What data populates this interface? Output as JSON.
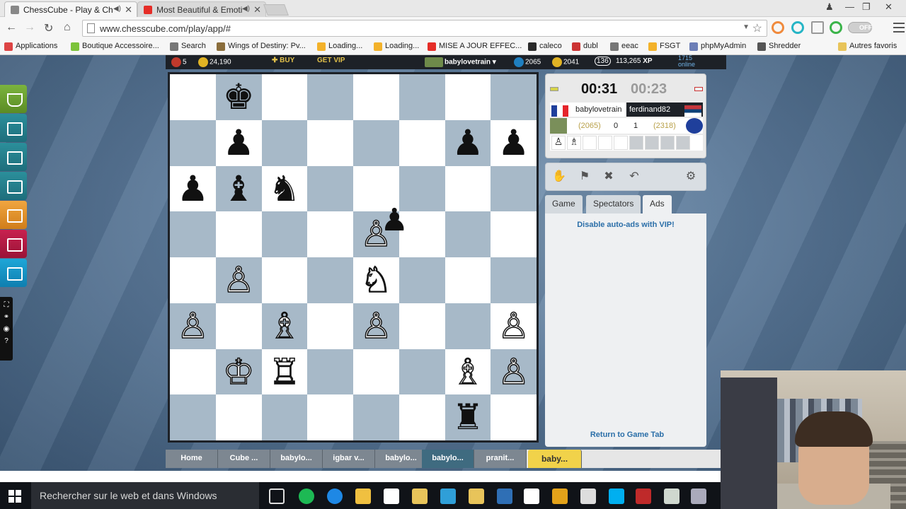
{
  "browser": {
    "tabs": [
      {
        "title": "ChessCube - Play & Ch",
        "active": true,
        "favicon_color": "#888888"
      },
      {
        "title": "Most Beautiful & Emoti",
        "active": false,
        "favicon_color": "#e52d27"
      }
    ],
    "url": "www.chesscube.com/play/app/#",
    "extension_toggle": "OFF",
    "bookmarks": [
      "Applications",
      "Boutique Accessoire...",
      "Search",
      "Wings of Destiny: Pv...",
      "Loading...",
      "Loading...",
      "MISE A JOUR EFFEC...",
      "caleco",
      "dubl",
      "eeac",
      "FSGT",
      "phpMyAdmin",
      "Shredder",
      "Autres favoris"
    ]
  },
  "site": {
    "topbar": {
      "crowns": "5",
      "coins": "24,190",
      "buy": "BUY",
      "get_vip": "GET VIP",
      "username": "babylovetrain",
      "rating1": "2065",
      "rating2": "2041",
      "level": "136",
      "xp": "113,265",
      "xp_label": "XP",
      "online_count": "1715",
      "online_label": "online"
    },
    "board": {
      "pieces": [
        {
          "sq": "b8",
          "p": "♚",
          "c": "b"
        },
        {
          "sq": "b7",
          "p": "♟",
          "c": "b"
        },
        {
          "sq": "g7",
          "p": "♟",
          "c": "b"
        },
        {
          "sq": "h7",
          "p": "♟",
          "c": "b"
        },
        {
          "sq": "a6",
          "p": "♟",
          "c": "b"
        },
        {
          "sq": "b6",
          "p": "♝",
          "c": "b"
        },
        {
          "sq": "c6",
          "p": "♞",
          "c": "b"
        },
        {
          "sq": "e5",
          "p": "♙",
          "c": "w"
        },
        {
          "sq": "b4",
          "p": "♙",
          "c": "w"
        },
        {
          "sq": "e4",
          "p": "♘",
          "c": "w"
        },
        {
          "sq": "a3",
          "p": "♙",
          "c": "w"
        },
        {
          "sq": "c3",
          "p": "♗",
          "c": "w"
        },
        {
          "sq": "e3",
          "p": "♙",
          "c": "w"
        },
        {
          "sq": "h3",
          "p": "♙",
          "c": "w"
        },
        {
          "sq": "b2",
          "p": "♔",
          "c": "w"
        },
        {
          "sq": "c2",
          "p": "♖",
          "c": "w"
        },
        {
          "sq": "g2",
          "p": "♗",
          "c": "w"
        },
        {
          "sq": "h2",
          "p": "♙",
          "c": "w"
        },
        {
          "sq": "g1",
          "p": "♜",
          "c": "b"
        }
      ],
      "floating_piece": {
        "p": "♟",
        "c": "b"
      }
    },
    "game": {
      "clock_left": "00:31",
      "clock_right": "00:23",
      "player_left": "babylovetrain",
      "player_right": "ferdinand82",
      "rating_left": "(2065)",
      "score_left": "0",
      "score_right": "1",
      "rating_right": "(2318)",
      "captured": [
        "♙",
        "♗"
      ]
    },
    "controls": [
      "draw-icon",
      "resign-flag-icon",
      "abort-icon",
      "undo-icon",
      "settings-icon"
    ],
    "panel_tabs": [
      "Game",
      "Spectators",
      "Ads"
    ],
    "panel": {
      "vip_link": "Disable auto-ads with VIP!",
      "return_link": "Return to Game Tab"
    },
    "bottom_tabs": [
      "Home",
      "Cube ...",
      "babylo...",
      "igbar v...",
      "babylo...",
      "babylo...",
      "pranit...",
      "baby..."
    ]
  },
  "taskbar": {
    "search_placeholder": "Rechercher sur le web et dans Windows"
  },
  "colors": {
    "board_light": "#ffffff",
    "board_dark": "#a7b9c8",
    "accent": "#f1d24a",
    "link": "#2a6ea8"
  }
}
